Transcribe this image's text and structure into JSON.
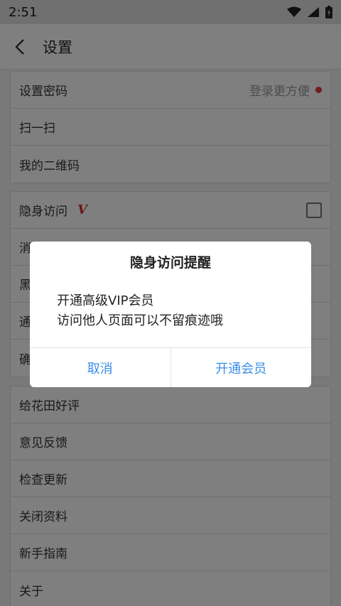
{
  "status": {
    "time": "2:51"
  },
  "header": {
    "title": "设置"
  },
  "group1": [
    {
      "label": "设置密码",
      "hint": "登录更方便"
    },
    {
      "label": "扫一扫"
    },
    {
      "label": "我的二维码"
    }
  ],
  "group2": [
    {
      "label": "隐身访问",
      "badge": "V"
    },
    {
      "label": "消息提醒"
    },
    {
      "label": "黑名单"
    },
    {
      "label": "通用"
    },
    {
      "label": "确认"
    }
  ],
  "group3": [
    {
      "label": "给花田好评"
    },
    {
      "label": "意见反馈"
    },
    {
      "label": "检查更新"
    },
    {
      "label": "关闭资料"
    },
    {
      "label": "新手指南"
    },
    {
      "label": "关于"
    }
  ],
  "dialog": {
    "title": "隐身访问提醒",
    "line1": "开通高级VIP会员",
    "line2": "访问他人页面可以不留痕迹哦",
    "cancel": "取消",
    "confirm": "开通会员"
  },
  "colors": {
    "accent": "#3a8ee6",
    "badge": "#d23131",
    "dot": "#e03c3c"
  },
  "icons": [
    "wifi-icon",
    "signal-icon",
    "battery-icon",
    "back-arrow-icon"
  ]
}
